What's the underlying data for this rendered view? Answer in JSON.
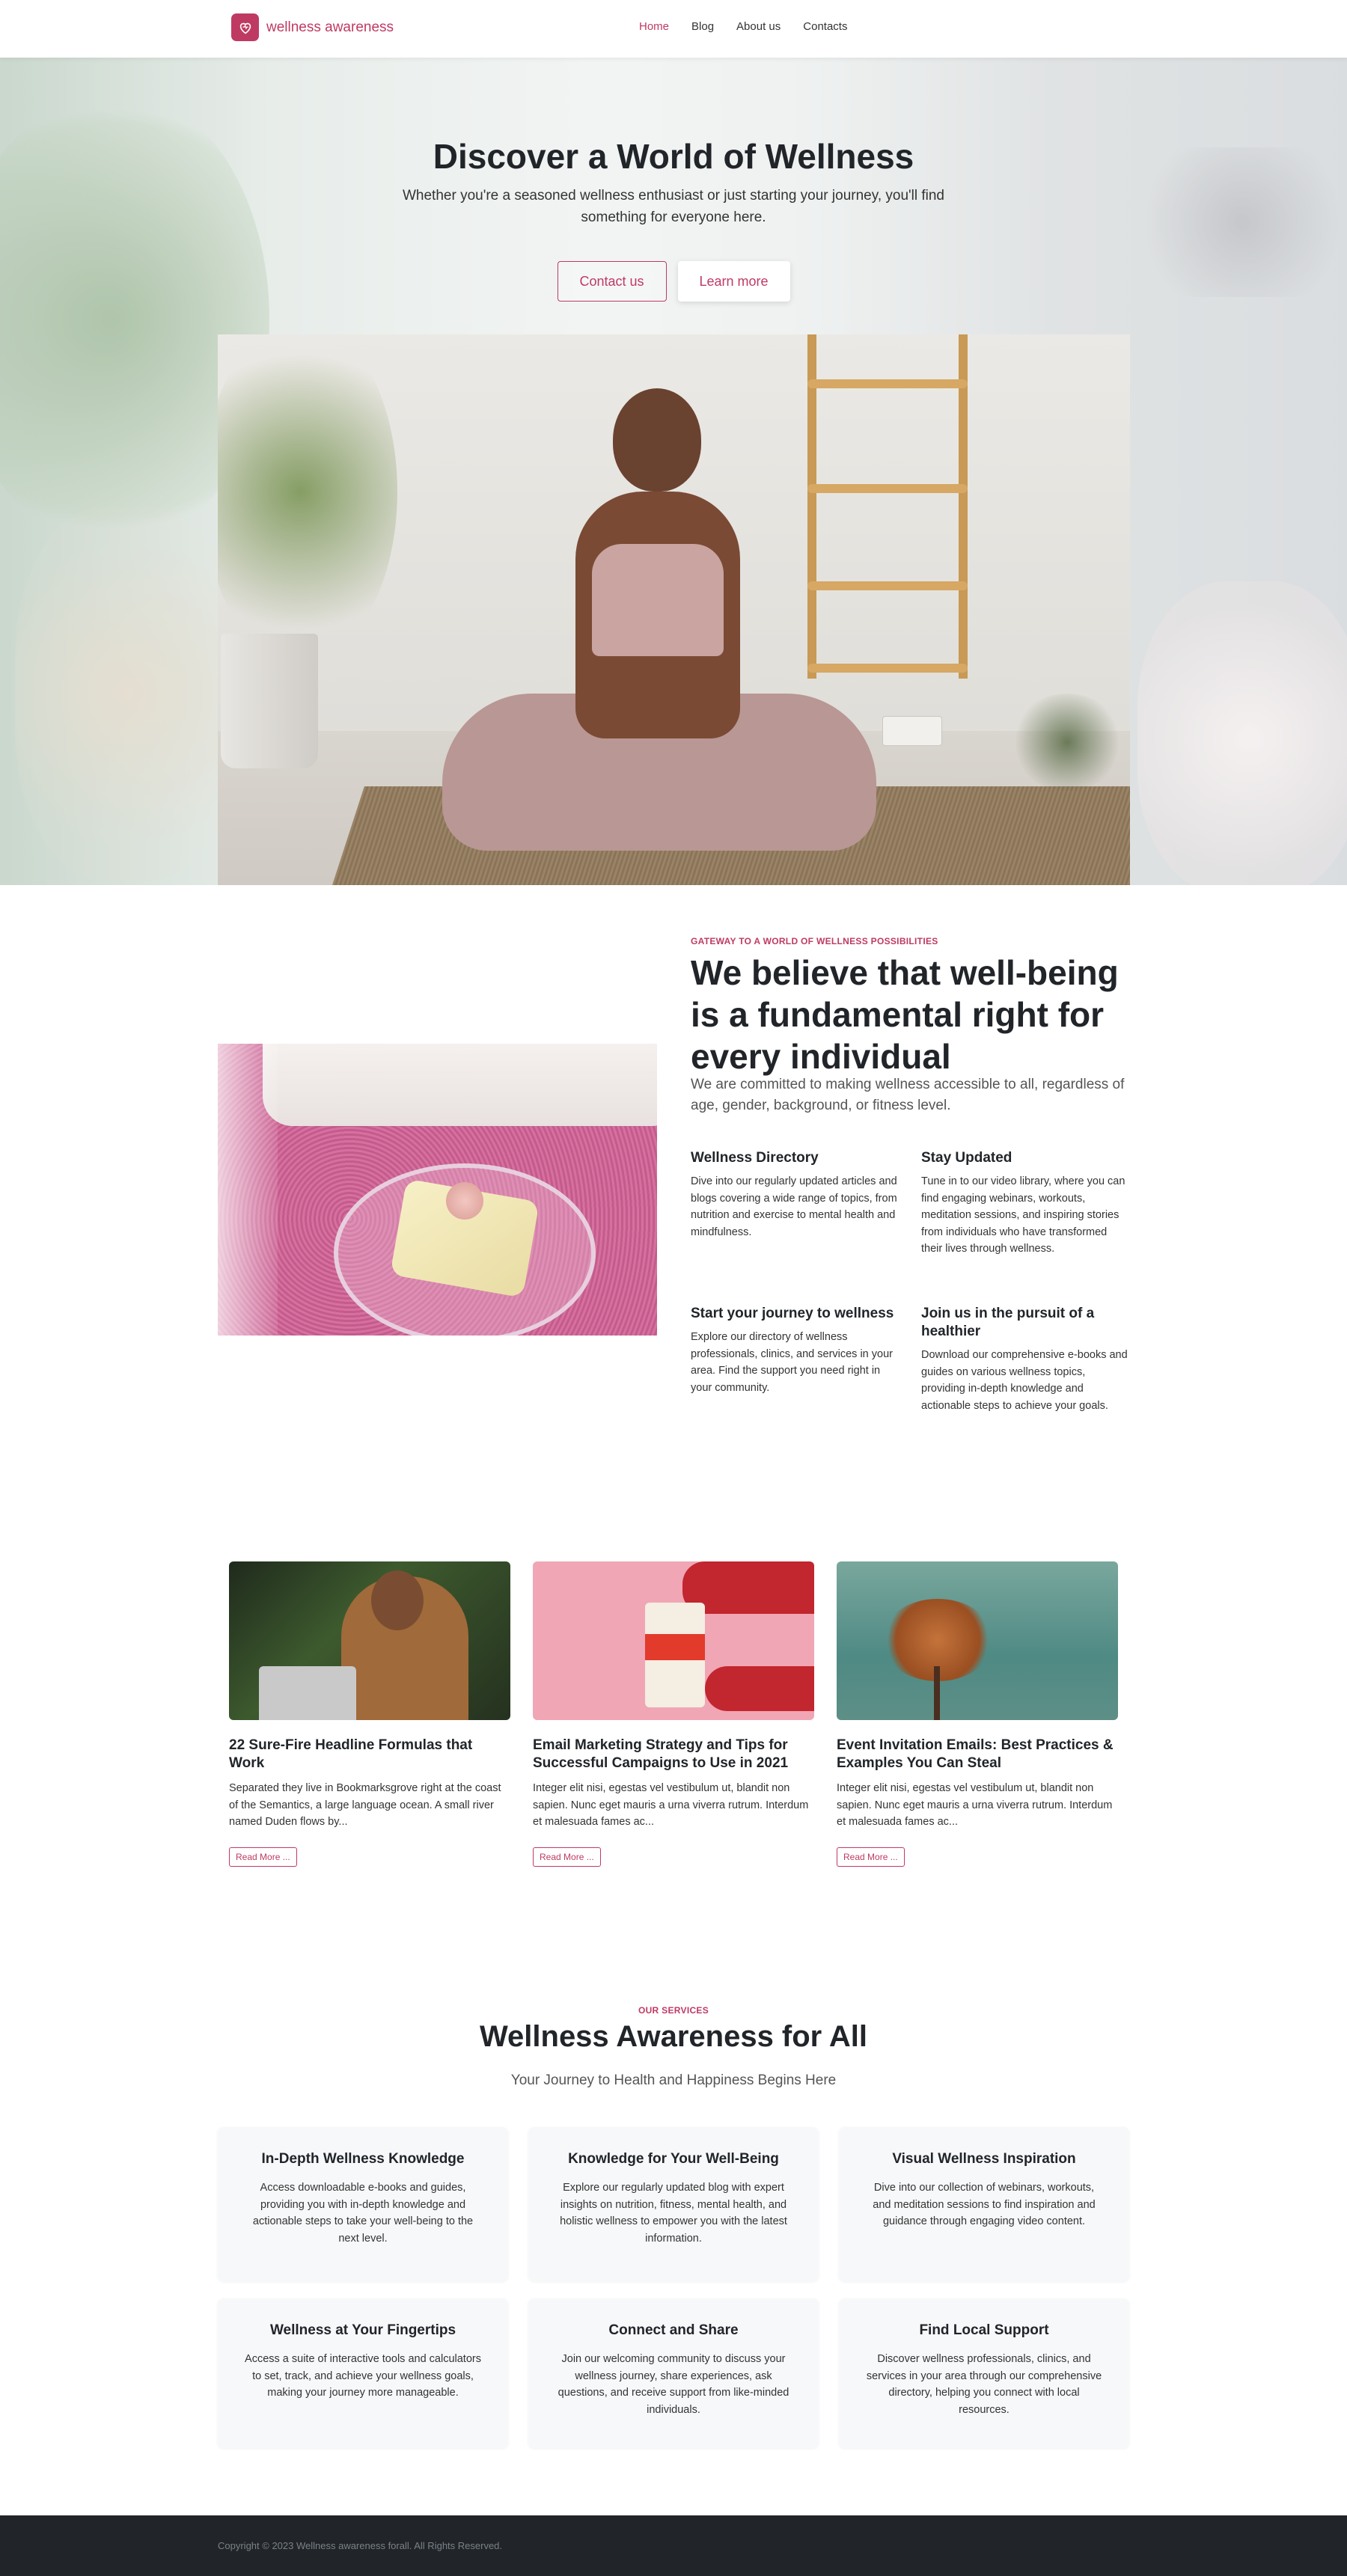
{
  "nav": {
    "brand": "wellness awareness",
    "links": [
      "Home",
      "Blog",
      "About us",
      "Contacts"
    ],
    "active": "Home"
  },
  "hero": {
    "title": "Discover a World of Wellness",
    "subtitle": "Whether you're a seasoned wellness enthusiast or just starting your journey, you'll find something for everyone here.",
    "btn_contact": "Contact us",
    "btn_learn": "Learn more"
  },
  "about": {
    "eyebrow": "GATEWAY TO A WORLD OF WELLNESS POSSIBILITIES",
    "title": "We believe that well-being is a fundamental right for every individual",
    "lead": "We are committed to making wellness accessible to all, regardless of age, gender, background, or fitness level.",
    "features": [
      {
        "title": "Wellness Directory",
        "text": "Dive into our regularly updated articles and blogs covering a wide range of topics, from nutrition and exercise to mental health and mindfulness."
      },
      {
        "title": "Stay Updated",
        "text": "Tune in to our video library, where you can find engaging webinars, workouts, meditation sessions, and inspiring stories from individuals who have transformed their lives through wellness."
      },
      {
        "title": "Start your journey to wellness",
        "text": "Explore our directory of wellness professionals, clinics, and services in your area. Find the support you need right in your community."
      },
      {
        "title": "Join us in the pursuit of a healthier",
        "text": "Download our comprehensive e-books and guides on various wellness topics, providing in-depth knowledge and actionable steps to achieve your goals."
      }
    ]
  },
  "blog": {
    "read_more": "Read More ...",
    "posts": [
      {
        "title": "22 Sure-Fire Headline Formulas that Work",
        "excerpt": "Separated they live in Bookmarksgrove right at the coast of the Semantics, a large language ocean. A small river named Duden flows by..."
      },
      {
        "title": "Email Marketing Strategy and Tips for Successful Campaigns to Use in 2021",
        "excerpt": "Integer elit nisi, egestas vel vestibulum ut, blandit non sapien. Nunc eget mauris a urna viverra rutrum. Interdum et malesuada fames ac..."
      },
      {
        "title": "Event Invitation Emails: Best Practices & Examples You Can Steal",
        "excerpt": "Integer elit nisi, egestas vel vestibulum ut, blandit non sapien. Nunc eget mauris a urna viverra rutrum. Interdum et malesuada fames ac..."
      }
    ]
  },
  "services": {
    "eyebrow": "OUR SERVICES",
    "title": "Wellness Awareness for All",
    "subtitle": "Your Journey to Health and Happiness Begins Here",
    "cards": [
      {
        "title": "In-Depth Wellness Knowledge",
        "text": "Access downloadable e-books and guides, providing you with in-depth knowledge and actionable steps to take your well-being to the next level."
      },
      {
        "title": "Knowledge for Your Well-Being",
        "text": "Explore our regularly updated blog with expert insights on nutrition, fitness, mental health, and holistic wellness to empower you with the latest information."
      },
      {
        "title": "Visual Wellness Inspiration",
        "text": "Dive into our collection of webinars, workouts, and meditation sessions to find inspiration and guidance through engaging video content."
      },
      {
        "title": "Wellness at Your Fingertips",
        "text": "Access a suite of interactive tools and calculators to set, track, and achieve your wellness goals, making your journey more manageable."
      },
      {
        "title": "Connect and Share",
        "text": "Join our welcoming community to discuss your wellness journey, share experiences, ask questions, and receive support from like-minded individuals."
      },
      {
        "title": "Find Local Support",
        "text": "Discover wellness professionals, clinics, and services in your area through our comprehensive directory, helping you connect with local resources."
      }
    ]
  },
  "footer": {
    "copyright": "Copyright © 2023 Wellness awareness forall. All Rights Reserved."
  },
  "colors": {
    "accent": "#bf3a63",
    "footer_bg": "#212529",
    "card_bg": "#f7f8fa"
  }
}
